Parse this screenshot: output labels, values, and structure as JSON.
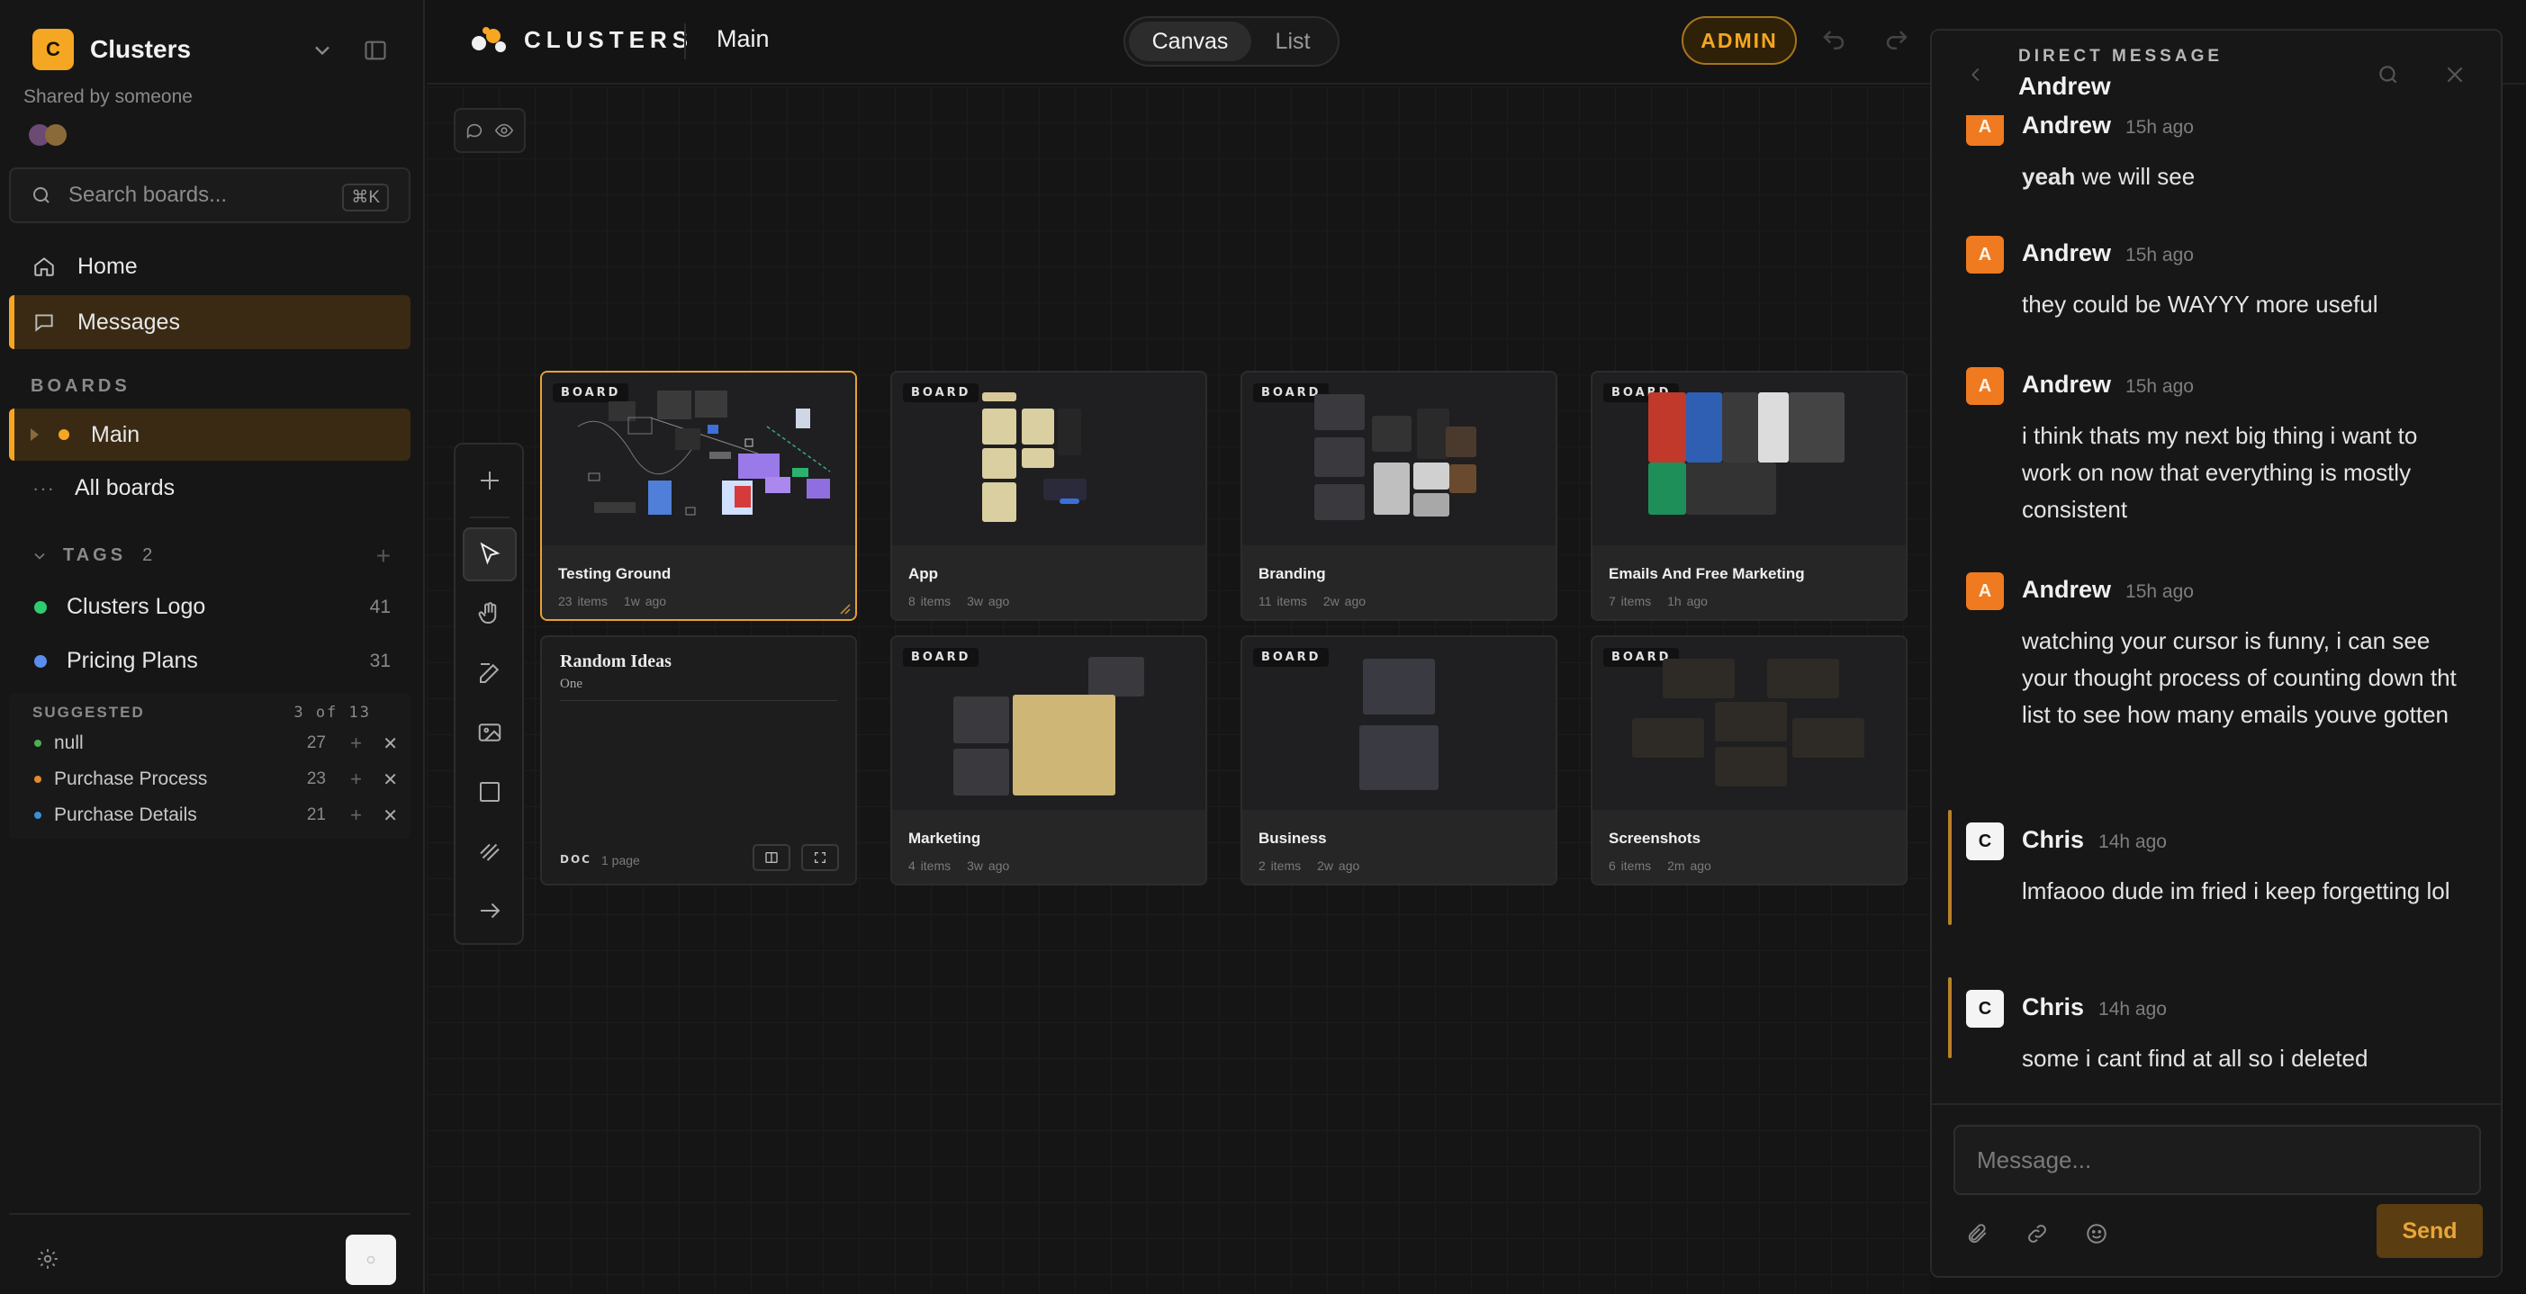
{
  "workspace": {
    "logo_letter": "C",
    "name": "Clusters",
    "shared_by": "Shared by someone"
  },
  "search": {
    "placeholder": "Search boards...",
    "shortcut": "⌘K"
  },
  "nav": [
    {
      "label": "Home",
      "icon": "home-icon"
    },
    {
      "label": "Messages",
      "icon": "message-icon",
      "active": true
    }
  ],
  "boards": {
    "label": "BOARDS",
    "items": [
      {
        "label": "Main",
        "active": true
      }
    ],
    "all_label": "All boards"
  },
  "tags": {
    "label": "TAGS",
    "count": "2",
    "items": [
      {
        "label": "Clusters Logo",
        "count": "41",
        "color": "#2ecc71"
      },
      {
        "label": "Pricing Plans",
        "count": "31",
        "color": "#5b8def"
      }
    ]
  },
  "suggested": {
    "label": "SUGGESTED",
    "count": "3 of 13",
    "items": [
      {
        "label": "null",
        "count": "27",
        "color": "#4caf50"
      },
      {
        "label": "Purchase Process",
        "count": "23",
        "color": "#e08a2e"
      },
      {
        "label": "Purchase Details",
        "count": "21",
        "color": "#3a8fd8"
      }
    ]
  },
  "topbar": {
    "brand": "CLUSTERS",
    "page": "Main",
    "views": [
      "Canvas",
      "List"
    ],
    "admin": "ADMIN"
  },
  "cards": [
    {
      "chip": "BOARD",
      "title": "Testing Ground",
      "items": "23 items",
      "age": "1w ago"
    },
    {
      "chip": "BOARD",
      "title": "App",
      "items": "8 items",
      "age": "3w ago"
    },
    {
      "chip": "BOARD",
      "title": "Branding",
      "items": "11 items",
      "age": "2w ago"
    },
    {
      "chip": "BOARD",
      "title": "Emails And Free Marketing",
      "items": "7 items",
      "age": "1h ago"
    },
    {
      "chip": "DOC",
      "title": "Random Ideas",
      "subtitle": "One",
      "items": "1 page"
    },
    {
      "chip": "BOARD",
      "title": "Marketing",
      "items": "4 items",
      "age": "3w ago"
    },
    {
      "chip": "BOARD",
      "title": "Business",
      "items": "2 items",
      "age": "2w ago"
    },
    {
      "chip": "BOARD",
      "title": "Screenshots",
      "items": "6 items",
      "age": "2m ago"
    }
  ],
  "dm": {
    "kicker": "DIRECT MESSAGE",
    "name": "Andrew",
    "messages": [
      {
        "author": "Andrew",
        "avatar": "A",
        "time": "15h ago",
        "lead": "yeah",
        "text": " we will see"
      },
      {
        "author": "Andrew",
        "avatar": "A",
        "time": "15h ago",
        "text": "they could be WAYYY more useful"
      },
      {
        "author": "Andrew",
        "avatar": "A",
        "time": "15h ago",
        "text": "i think thats my next big thing i want to work on now that everything is mostly consistent"
      },
      {
        "author": "Andrew",
        "avatar": "A",
        "time": "15h ago",
        "text": "watching your cursor is funny, i can see your thought process of counting down tht list to see how many emails youve gotten"
      },
      {
        "author": "Chris",
        "avatar": "C",
        "time": "14h ago",
        "text": "lmfaooo dude im fried i keep forgetting lol"
      },
      {
        "author": "Chris",
        "avatar": "C",
        "time": "14h ago",
        "text": "some i cant find at all so i deleted"
      }
    ],
    "input_placeholder": "Message...",
    "send": "Send"
  },
  "colors": {
    "accent": "#f5a623",
    "avatar_andrew": "#f07a1f",
    "avatar_chris": "#f4f4f4"
  }
}
